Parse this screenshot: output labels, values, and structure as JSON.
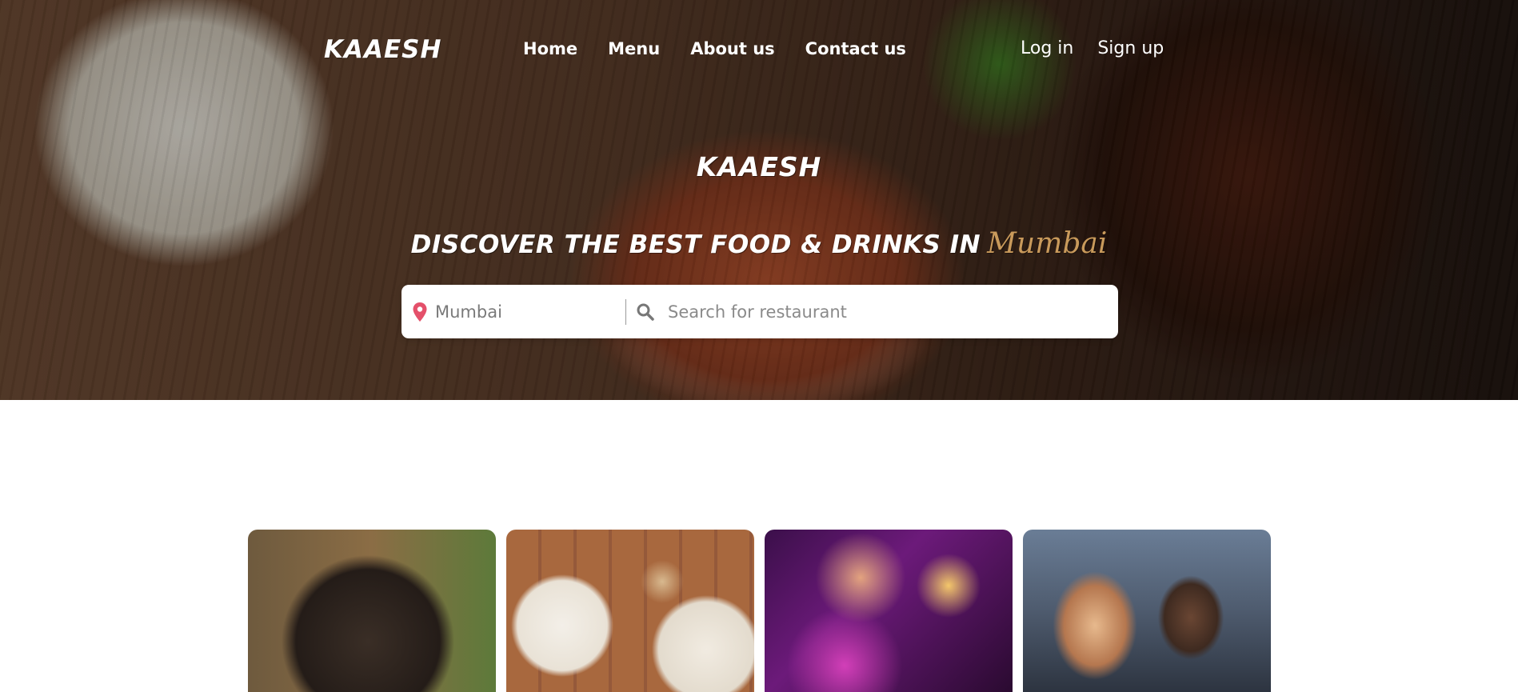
{
  "header": {
    "logo": "KAAESH",
    "nav": [
      {
        "label": "Home"
      },
      {
        "label": "Menu"
      },
      {
        "label": "About us"
      },
      {
        "label": "Contact us"
      }
    ],
    "auth": {
      "login": "Log in",
      "signup": "Sign up"
    }
  },
  "hero": {
    "title": "KAAESH",
    "tagline": "DISCOVER THE BEST FOOD & DRINKS IN",
    "city": "Mumbai"
  },
  "search": {
    "location": "Mumbai",
    "placeholder": "Search for restaurant",
    "icons": {
      "location": "map-pin-icon",
      "search": "search-icon"
    }
  },
  "cards": [
    {
      "image": "food-bowl-photo"
    },
    {
      "image": "breakfast-table-photo"
    },
    {
      "image": "cocktail-bar-photo"
    },
    {
      "image": "friends-toast-photo"
    }
  ],
  "colors": {
    "accent_city": "#c99a5b",
    "pin": "#e4506a",
    "text_light": "#ffffff"
  }
}
